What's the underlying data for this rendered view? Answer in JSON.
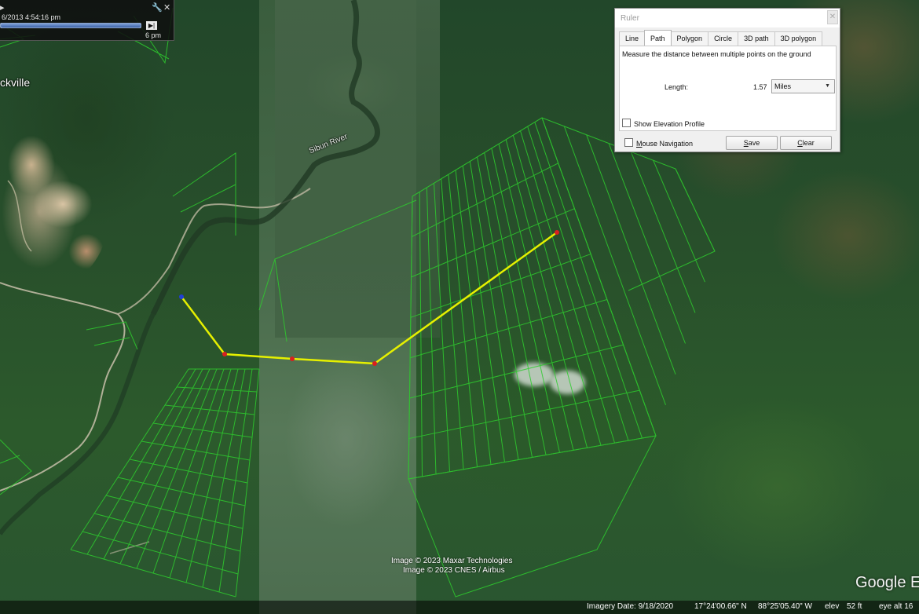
{
  "time_slider": {
    "timestamp": "6/2013  4:54:16 pm",
    "end_label": "6 pm",
    "position": 1.0,
    "wrench_icon": "wrench-icon",
    "close_icon": "close-icon",
    "play_icon": "play-end-icon"
  },
  "map_labels": {
    "town": "ckville",
    "river": "Sibun River"
  },
  "ruler": {
    "title": "Ruler",
    "close_glyph": "✕",
    "tabs": [
      {
        "label": "Line",
        "active": false
      },
      {
        "label": "Path",
        "active": true
      },
      {
        "label": "Polygon",
        "active": false
      },
      {
        "label": "Circle",
        "active": false
      },
      {
        "label": "3D path",
        "active": false
      },
      {
        "label": "3D polygon",
        "active": false
      }
    ],
    "description": "Measure the distance between multiple points on the ground",
    "length_label": "Length:",
    "length_value": "1.57",
    "unit_selected": "Miles",
    "show_elevation_label": "Show Elevation Profile",
    "show_elevation_checked": false,
    "mouse_navigation_label": "Mouse Navigation",
    "mouse_navigation_checked": false,
    "save_label": "Save",
    "clear_label": "Clear"
  },
  "path": {
    "line_color": "#e6f000",
    "start_point_color": "#1f3fd8",
    "vertex_color": "#d82020"
  },
  "parcel_color": "#2ecc2e",
  "attribution": {
    "line1": "Image © 2023 Maxar Technologies",
    "line2": "Image © 2023 CNES / Airbus"
  },
  "logo": "Google E",
  "status_bar": {
    "imagery_date": "Imagery Date: 9/18/2020",
    "latitude": "17°24'00.66\" N",
    "longitude": "88°25'05.40\" W",
    "elev_label": "elev",
    "elev_value": "52 ft",
    "eye_alt": "eye alt  16"
  }
}
